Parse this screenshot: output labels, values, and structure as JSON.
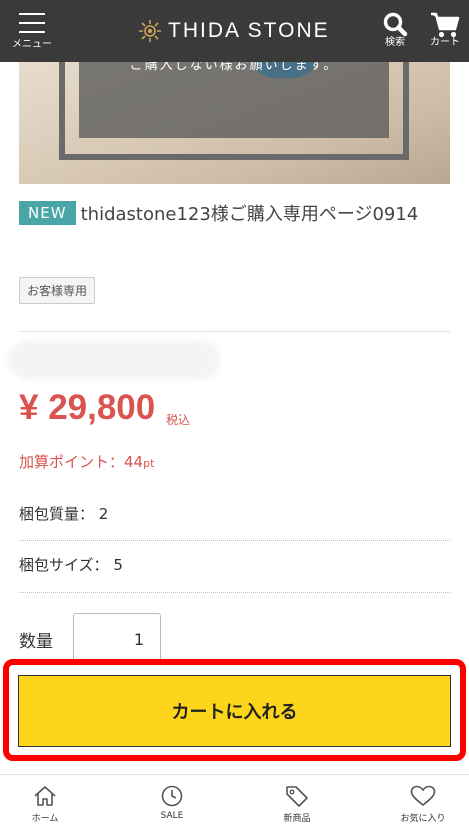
{
  "header": {
    "menu_label": "メニュー",
    "brand": "THIDA STONE",
    "search_label": "検索",
    "cart_label": "カート"
  },
  "hero": {
    "caption": "ご購入しない様お願いします。"
  },
  "product": {
    "badge": "NEW",
    "title": "thidastone123様ご購入専用ページ0914",
    "tag": "お客様専用",
    "price": "¥ 29,800",
    "tax_note": "税込",
    "points_label": "加算ポイント：44",
    "points_unit": "pt",
    "specs": [
      {
        "label": "梱包質量：",
        "value": "2"
      },
      {
        "label": "梱包サイズ：",
        "value": "5"
      }
    ],
    "quantity_label": "数量",
    "quantity_value": "1",
    "add_to_cart": "カートに入れる"
  },
  "colors": {
    "header_bg": "#3a3a3a",
    "accent_red": "#d9534f",
    "cart_button": "#fdd51a",
    "badge": "#4aa6a6",
    "highlight": "#ff0000"
  },
  "bottom_nav": [
    {
      "label": "ホーム",
      "icon": "home-icon"
    },
    {
      "label": "SALE",
      "icon": "clock-icon"
    },
    {
      "label": "新商品",
      "icon": "tag-icon"
    },
    {
      "label": "お気に入り",
      "icon": "heart-icon"
    }
  ]
}
